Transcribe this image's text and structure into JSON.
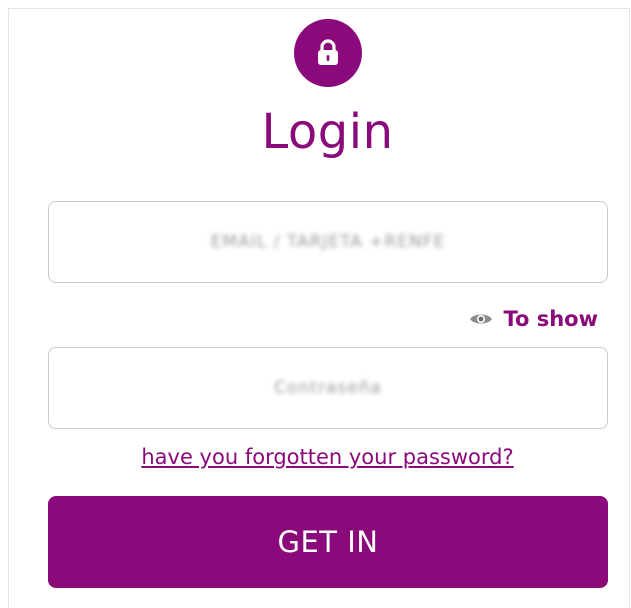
{
  "header": {
    "icon": "lock-icon",
    "title": "Login"
  },
  "form": {
    "email": {
      "placeholder": "EMAIL / TARJETA +RENFE",
      "value": ""
    },
    "password": {
      "placeholder": "Contraseña",
      "value": "",
      "show_toggle_icon": "eye-icon",
      "show_toggle_label": "To show"
    },
    "forgot_link": "have you forgotten your password?",
    "submit_label": "GET IN"
  },
  "colors": {
    "accent": "#8a0a7b",
    "border": "#c9c9c9",
    "background": "#ffffff"
  }
}
